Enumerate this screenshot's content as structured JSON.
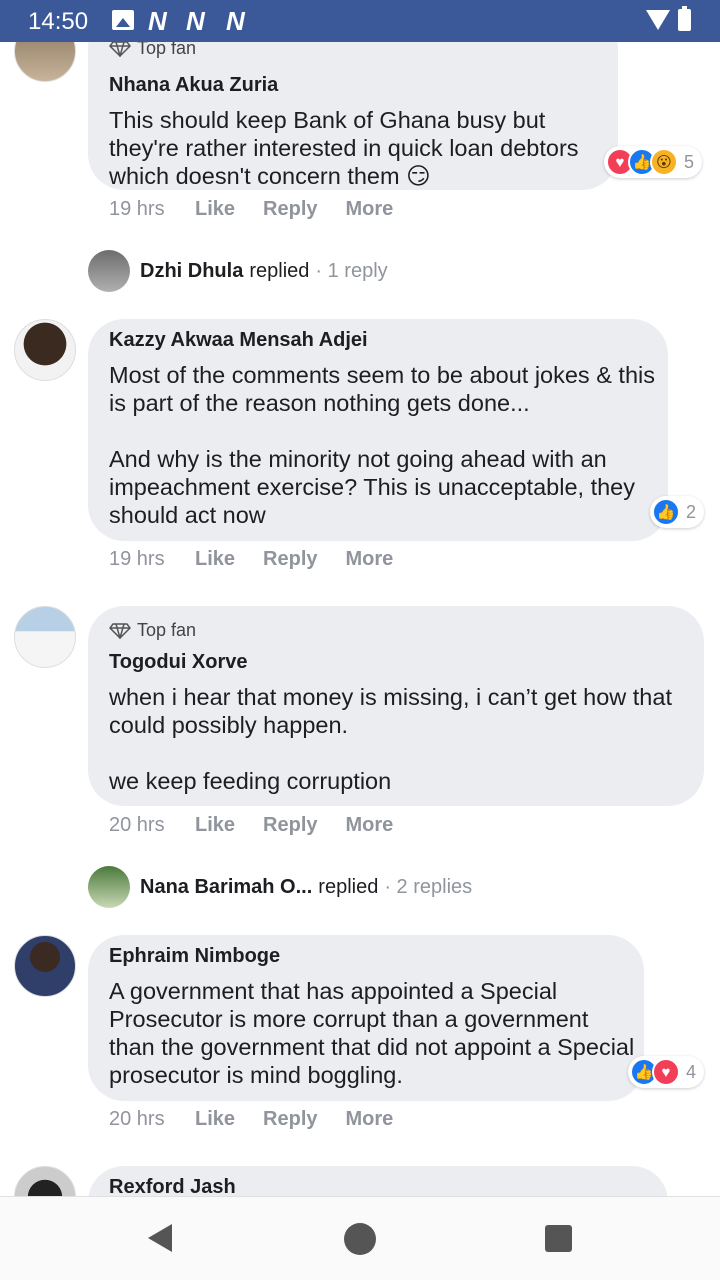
{
  "status": {
    "time": "14:50",
    "notif_icons": [
      "N",
      "N",
      "N"
    ]
  },
  "comments": [
    {
      "top_fan_label": "Top fan",
      "author": "Nhana Akua Zuria",
      "text": "This should keep Bank of Ghana busy but they're rather interested in quick loan debtors which doesn't concern them 😏",
      "time": "19 hrs",
      "like": "Like",
      "reply": "Reply",
      "more": "More",
      "reactions": [
        "love",
        "like",
        "wow"
      ],
      "reaction_count": "5"
    },
    {
      "author": "Kazzy Akwaa Mensah Adjei",
      "text": "Most of the comments seem to be about jokes & this is part of the reason nothing gets done...\n\nAnd why is the minority not going ahead with an impeachment exercise? This is unacceptable, they should act now",
      "time": "19 hrs",
      "like": "Like",
      "reply": "Reply",
      "more": "More",
      "reactions": [
        "like"
      ],
      "reaction_count": "2"
    },
    {
      "top_fan_label": "Top fan",
      "author": "Togodui Xorve",
      "text": "when i hear that money is missing, i can’t get how that could possibly happen.\n\nwe keep feeding corruption",
      "time": "20 hrs",
      "like": "Like",
      "reply": "Reply",
      "more": "More"
    },
    {
      "author": "Ephraim Nimboge",
      "text": "A government that has appointed a Special Prosecutor is more corrupt than a government than the government that did not appoint a Special prosecutor is mind boggling.",
      "time": "20 hrs",
      "like": "Like",
      "reply": "Reply",
      "more": "More",
      "reactions": [
        "like",
        "love"
      ],
      "reaction_count": "4"
    },
    {
      "author": "Rexford Jash"
    }
  ],
  "replies": [
    {
      "name": "Dzhi Dhula",
      "verb": "replied",
      "count": "· 1 reply"
    },
    {
      "name": "Nana Barimah O...",
      "verb": "replied",
      "count": "· 2 replies"
    }
  ],
  "colors": {
    "status_bar": "#3b5998",
    "bubble": "#ebedf0",
    "like_blue": "#1877f2",
    "love_red": "#f33e58",
    "wow_yellow": "#f7b125"
  }
}
